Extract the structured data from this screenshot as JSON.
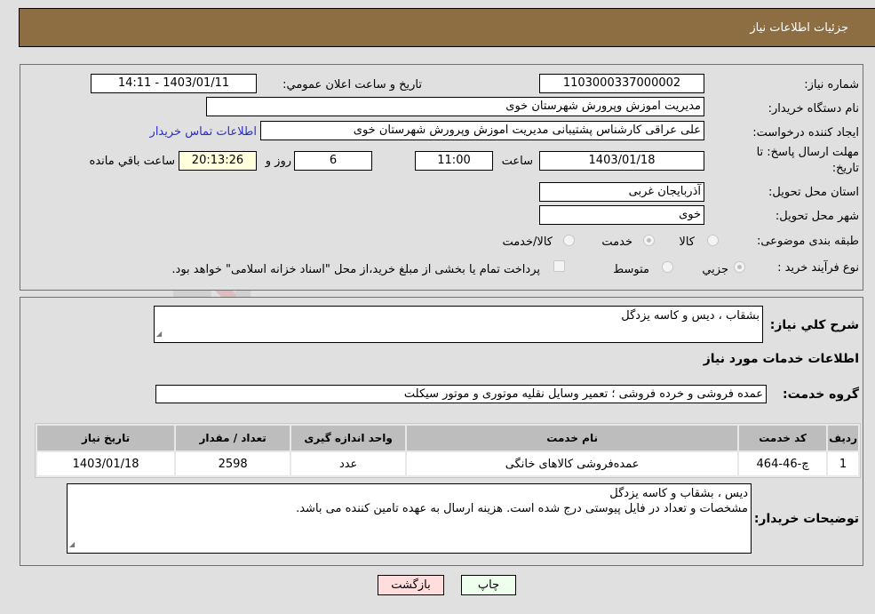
{
  "header": {
    "title": "جزئیات اطلاعات نیاز"
  },
  "details": {
    "need_number_label": "شماره نیاز:",
    "need_number": "1103000337000002",
    "announce_label": "تاریخ و ساعت اعلان عمومي:",
    "announce_value": "1403/01/11 - 14:11",
    "buyer_org_label": "نام دستگاه خریدار:",
    "buyer_org": "مدیریت اموزش وپرورش شهرستان خوی",
    "creator_label": "ایجاد کننده درخواست:",
    "creator": "علی عراقی کارشناس پشتیبانی مدیریت اموزش وپرورش شهرستان خوی",
    "contact_link": "اطلاعات تماس خریدار",
    "deadline_label_1": "مهلت ارسال پاسخ: تا",
    "deadline_label_2": "تاریخ:",
    "deadline_date": "1403/01/18",
    "time_label": "ساعت",
    "deadline_time": "11:00",
    "days_value": "6",
    "days_label": "روز و",
    "remaining_time": "20:13:26",
    "remaining_label": "ساعت باقي مانده",
    "province_label": "استان محل تحویل:",
    "province": "آذربایجان غربی",
    "city_label": "شهر محل تحویل:",
    "city": "خوی",
    "category_label": "طبقه بندی موضوعی:",
    "category_options": [
      {
        "label": "کالا",
        "checked": false
      },
      {
        "label": "خدمت",
        "checked": true
      },
      {
        "label": "کالا/خدمت",
        "checked": false
      }
    ],
    "process_label": "نوع فرآیند خرید :",
    "process_options": [
      {
        "label": "جزيي",
        "checked": true
      },
      {
        "label": "متوسط",
        "checked": false
      }
    ],
    "payment_note": "پرداخت تمام یا بخشی از مبلغ خرید،از محل \"اسناد خزانه اسلامی\" خواهد بود.",
    "payment_checked": false
  },
  "services": {
    "summary_label": "شرح کلي نياز:",
    "summary": "بشقاب ، دیس  و کاسه یزدگل",
    "section_title": "اطلاعات خدمات مورد نیاز",
    "group_label": "گروه خدمت:",
    "group": "عمده فروشی و خرده فروشی ؛ تعمیر وسایل نقلیه موتوری و موتور سیکلت",
    "table": {
      "headers": [
        "ردیف",
        "کد خدمت",
        "نام خدمت",
        "واحد اندازه گیری",
        "تعداد / مقدار",
        "تاریخ نیاز"
      ],
      "rows": [
        [
          "1",
          "چ-46-464",
          "عمده‌فروشی کالاهای خانگی",
          "عدد",
          "2598",
          "1403/01/18"
        ]
      ]
    },
    "buyer_notes_label": "توضیحات خریدار:",
    "buyer_notes_line1": "دیس ، بشقاب و  کاسه یزدگل",
    "buyer_notes_line2": "مشخصات و تعداد در فایل پیوستی درج شده است. هزینه ارسال به عهده تامین کننده می باشد."
  },
  "buttons": {
    "print": "چاپ",
    "back": "بازگشت"
  },
  "watermark": {
    "text": "AriaTender.neT"
  },
  "colors": {
    "header_bg": "#8d6e42",
    "back_button_bg": "#ffdddd",
    "print_button_bg": "#eeffee",
    "remaining_bg": "#ffffdd",
    "link": "#2a2ad0"
  }
}
